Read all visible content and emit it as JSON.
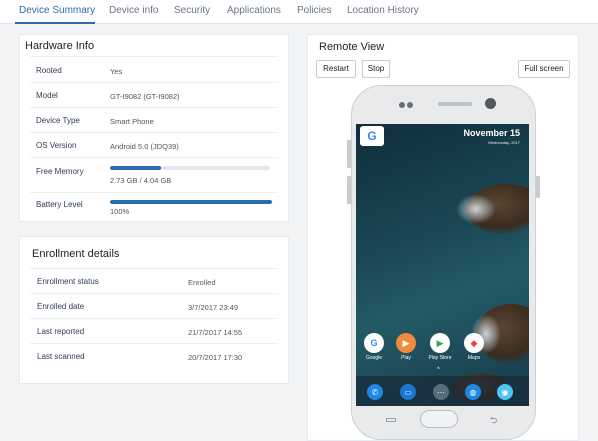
{
  "tabs": [
    "Device Summary",
    "Device info",
    "Security",
    "Applications",
    "Policies",
    "Location History"
  ],
  "hardware": {
    "title": "Hardware Info",
    "rows": [
      {
        "label": "Rooted",
        "value": "Yes"
      },
      {
        "label": "Model",
        "value": "GT-I9082 (GT-I9082)"
      },
      {
        "label": "Device Type",
        "value": "Smart Phone"
      },
      {
        "label": "OS Version",
        "value": "Android 5.0 (JDQ39)"
      },
      {
        "label": "Free Memory",
        "value": "2.73 GB / 4.04 GB",
        "progress": 0.32
      },
      {
        "label": "Battery Level",
        "value": "100%",
        "progress": 1.0
      }
    ]
  },
  "enrollment": {
    "title": "Enrollment details",
    "rows": [
      {
        "label": "Enrollment status",
        "value": "Enrolled"
      },
      {
        "label": "Enrolled date",
        "value": "3/7/2017 23:49"
      },
      {
        "label": "Last reported",
        "value": "21/7/2017 14:55"
      },
      {
        "label": "Last scanned",
        "value": "20/7/2017 17:30"
      }
    ]
  },
  "remote": {
    "title": "Remote View",
    "restart_label": "Restart",
    "stop_label": "Stop",
    "fullscreen_label": "Full screen",
    "phone": {
      "google_letter": "G",
      "date": "November 15",
      "subdate": "Wednesday, 2017",
      "apps": [
        "Google",
        "Play",
        "Play Store",
        "Maps"
      ]
    }
  },
  "colors": {
    "accent": "#2b6cb0",
    "bar": "#2a6ab0"
  }
}
